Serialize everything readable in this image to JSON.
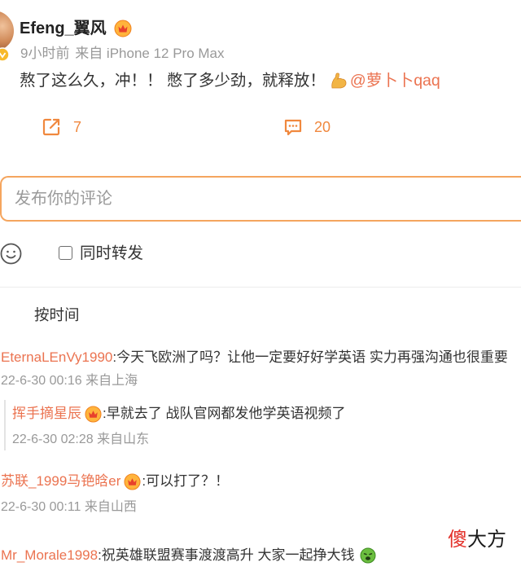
{
  "colors": {
    "link": "#EB7350",
    "accent": "#F0883E",
    "input_border": "#F5A55E",
    "text": "#333333",
    "muted": "#999999",
    "watermark_red": "#E3322B",
    "divider": "#ECECEC"
  },
  "post": {
    "author": "Efeng_翼风",
    "author_badge_icon": "vip-badge-icon",
    "verified_icon": "verified-badge-icon",
    "time": "9小时前",
    "source": "来自 iPhone 12 Pro Max",
    "text": "熬了这么久，冲！！ 憋了多少劲，就释放！",
    "text_emoji_icon": "muscle-emoji-icon",
    "mention": "@萝卜卜qaq",
    "actions": {
      "repost": {
        "icon": "repost-icon",
        "count": "7"
      },
      "comment": {
        "icon": "comment-icon",
        "count": "20"
      }
    }
  },
  "composer": {
    "placeholder": "发布你的评论",
    "emoji_icon": "smile-icon",
    "also_repost": {
      "checked": false,
      "label": "同时转发"
    }
  },
  "sort": {
    "label": "按时间"
  },
  "comments": [
    {
      "user": "EternaLEnVy1990",
      "text": ":今天飞欧洲了吗？让他一定要好好学英语 实力再强沟通也很重要",
      "meta": "22-6-30 00:16 来自上海",
      "replies": [
        {
          "user": "挥手摘星辰",
          "badge_icon": "vip-badge-icon",
          "text": ":早就去了 战队官网都发他学英语视频了",
          "meta": "22-6-30 02:28 来自山东"
        }
      ]
    },
    {
      "user": "苏联_1999马铯晗er",
      "badge_icon": "vip-badge-icon",
      "text": ":可以打了？！",
      "meta": "22-6-30 00:11 来自山西"
    },
    {
      "user": "Mr_Morale1998",
      "text": ":祝英雄联盟赛事渡渡高升 大家一起挣大钱",
      "emoji_icon": "green-face-emoji-icon"
    }
  ],
  "watermark": {
    "char1": "傻",
    "rest": "大方"
  }
}
